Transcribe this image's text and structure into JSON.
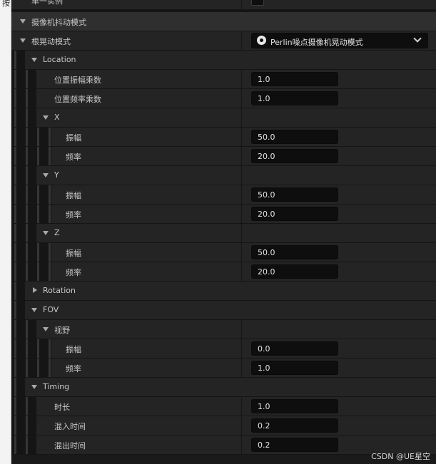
{
  "left_gutter_text": "按",
  "rows": {
    "single_instance": {
      "label": "单一实例"
    },
    "camera_shake_pattern": {
      "label": "摄像机抖动模式"
    },
    "root_shake_pattern": {
      "label": "根晃动模式",
      "dropdown_value": "Perlin噪点摄像机晃动模式"
    },
    "location": {
      "label": "Location"
    },
    "location_amplitude_multiplier": {
      "label": "位置振幅乘数",
      "value": "1.0"
    },
    "location_frequency_multiplier": {
      "label": "位置频率乘数",
      "value": "1.0"
    },
    "x": {
      "label": "X"
    },
    "x_amplitude": {
      "label": "振幅",
      "value": "50.0"
    },
    "x_frequency": {
      "label": "频率",
      "value": "20.0"
    },
    "y": {
      "label": "Y"
    },
    "y_amplitude": {
      "label": "振幅",
      "value": "50.0"
    },
    "y_frequency": {
      "label": "频率",
      "value": "20.0"
    },
    "z": {
      "label": "Z"
    },
    "z_amplitude": {
      "label": "振幅",
      "value": "50.0"
    },
    "z_frequency": {
      "label": "频率",
      "value": "20.0"
    },
    "rotation": {
      "label": "Rotation"
    },
    "fov": {
      "label": "FOV"
    },
    "fov_view": {
      "label": "视野"
    },
    "fov_amplitude": {
      "label": "振幅",
      "value": "0.0"
    },
    "fov_frequency": {
      "label": "频率",
      "value": "1.0"
    },
    "timing": {
      "label": "Timing"
    },
    "duration": {
      "label": "时长",
      "value": "1.0"
    },
    "blend_in_time": {
      "label": "混入时间",
      "value": "0.2"
    },
    "blend_out_time": {
      "label": "混出时间",
      "value": "0.2"
    }
  },
  "watermark": "CSDN @UE星空"
}
